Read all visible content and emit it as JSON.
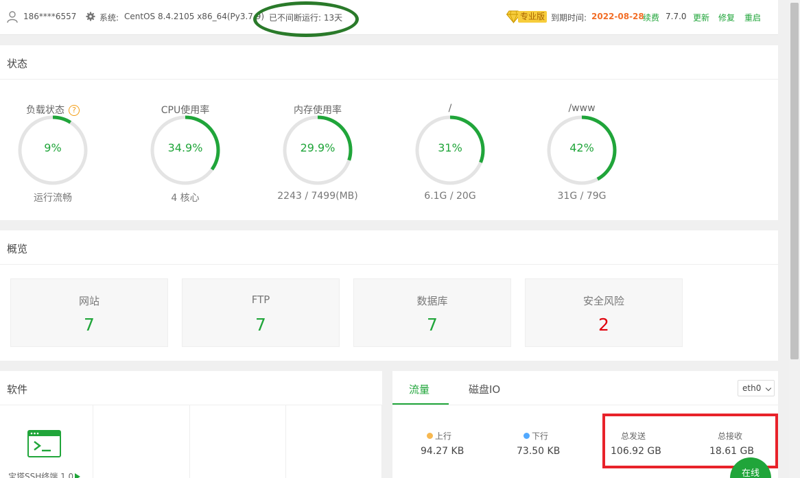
{
  "topbar": {
    "user": "186****6557",
    "system_label": "系统:",
    "system_value": "CentOS 8.4.2105 x86_64(Py3.7.9)",
    "uptime": "已不间断运行: 13天",
    "edition": "专业版",
    "expire_label": "到期时间:",
    "expire_date": "2022-08-28",
    "renew": "续费",
    "version": "7.7.0",
    "update": "更新",
    "repair": "修复",
    "restart": "重启"
  },
  "status": {
    "title": "状态",
    "gauges": [
      {
        "title": "负载状态",
        "value_text": "9%",
        "percent": 9,
        "sub": "运行流畅",
        "help": "?"
      },
      {
        "title": "CPU使用率",
        "value_text": "34.9%",
        "percent": 34.9,
        "sub": "4 核心"
      },
      {
        "title": "内存使用率",
        "value_text": "29.9%",
        "percent": 29.9,
        "sub": "2243 / 7499(MB)"
      },
      {
        "title": "/",
        "value_text": "31%",
        "percent": 31,
        "sub": "6.1G / 20G"
      },
      {
        "title": "/www",
        "value_text": "42%",
        "percent": 42,
        "sub": "31G / 79G"
      }
    ]
  },
  "overview": {
    "title": "概览",
    "items": [
      {
        "label": "网站",
        "value": "7"
      },
      {
        "label": "FTP",
        "value": "7"
      },
      {
        "label": "数据库",
        "value": "7"
      },
      {
        "label": "安全风险",
        "value": "2"
      }
    ]
  },
  "software": {
    "title": "软件",
    "items": [
      {
        "name": "宝塔SSH终端 1.0"
      }
    ]
  },
  "traffic": {
    "tabs": [
      "流量",
      "磁盘IO"
    ],
    "interface": "eth0",
    "up_label": "上行",
    "up_value": "94.27 KB",
    "down_label": "下行",
    "down_value": "73.50 KB",
    "total_sent_label": "总发送",
    "total_sent_value": "106.92 GB",
    "total_recv_label": "总接收",
    "total_recv_value": "18.61 GB",
    "up_color": "#f7b851",
    "down_color": "#52a9ff"
  },
  "online_button": "在线",
  "colors": {
    "accent": "#20a53a",
    "danger": "#e0000b",
    "track": "#e4e4e4",
    "highlight_red": "#e8222a",
    "uptime_circle": "#2a7a2a"
  }
}
